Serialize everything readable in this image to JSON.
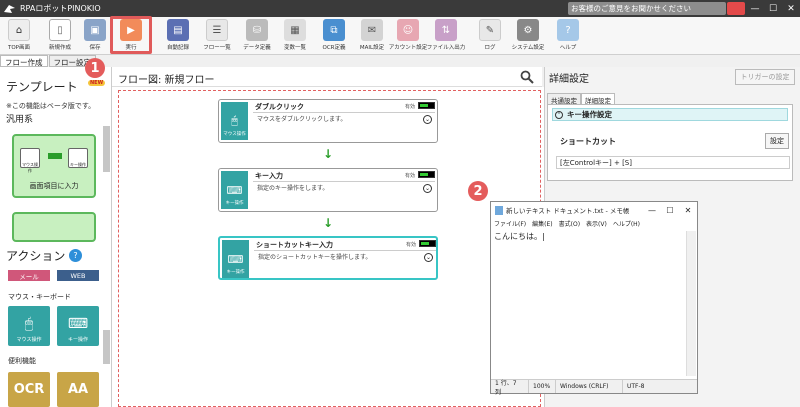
{
  "titlebar": {
    "app_title": "RPAロボットPINOKIO",
    "feedback": "お客様のご意見をお聞かせください",
    "minimize": "—",
    "maximize": "☐",
    "close": "✕"
  },
  "toolbar": {
    "top_label": "TOP画面",
    "new_label": "新規作成",
    "save_label": "保存",
    "run_label": "実行",
    "autorec_label": "自動記録",
    "flowlist_label": "フロー一覧",
    "datadef_label": "データ定義",
    "varlist_label": "変数一覧",
    "ocr_label": "OCR定義",
    "mail_label": "MAIL設定",
    "account_label": "アカウント設定",
    "file_label": "ファイル入出力",
    "log_label": "ログ",
    "system_label": "システム設定",
    "help_label": "ヘルプ"
  },
  "left_tabs": {
    "flow_create": "フロー作成",
    "flow_settings": "フロー設定"
  },
  "left_panel": {
    "template_title": "テンプレート",
    "new_tag": "NEW",
    "badge1": "1",
    "beta_note": "※この機能はベータ版です。",
    "category_general": "汎用系",
    "template_card_label": "画面項目に入力",
    "template_card_mini_left": "マウス操作",
    "template_card_mini_right": "キー操作",
    "action_title": "アクション",
    "help_q": "?",
    "chip_mail": "メール",
    "chip_web": "WEB",
    "cat_mouse_key": "マウス・キーボード",
    "tile_mouse": "マウス操作",
    "tile_key": "キー操作",
    "cat_convenient": "便利機能",
    "tile_ocr": "OCR",
    "tile_aa": "AA"
  },
  "flow": {
    "header": "フロー図:  新規フロー",
    "nodes": [
      {
        "name": "ダブルクリック",
        "desc": "マウスをダブルクリックします。",
        "enabled": "有効",
        "icon_label": "マウス操作"
      },
      {
        "name": "キー入力",
        "desc": "指定のキー操作をします。",
        "enabled": "有効",
        "icon_label": "キー操作"
      },
      {
        "name": "ショートカットキー入力",
        "desc": "指定のショートカットキーを操作します。",
        "enabled": "有効",
        "icon_label": "キー操作"
      }
    ],
    "badge2": "2"
  },
  "right_panel": {
    "title": "詳細設定",
    "trigger_btn": "トリガーの設定",
    "tab_common": "共通設定",
    "tab_detail": "詳細設定",
    "section": "キー操作設定",
    "shortcut_label": "ショートカット",
    "settings_btn": "設定",
    "shortcut_value": "[左Controlキー] + [S]"
  },
  "notepad": {
    "title": "新しいテキスト ドキュメント.txt - メモ帳",
    "menu": [
      "ファイル(F)",
      "編集(E)",
      "書式(O)",
      "表示(V)",
      "ヘルプ(H)"
    ],
    "content": "こんにちは。|",
    "status_pos": "1 行、7 列",
    "status_zoom": "100%",
    "status_eol": "Windows (CRLF)",
    "status_enc": "UTF-8"
  },
  "colors": {
    "accent_teal": "#33a3a3",
    "highlight_red": "#e05a5a",
    "toggle_green": "#33cc33"
  }
}
